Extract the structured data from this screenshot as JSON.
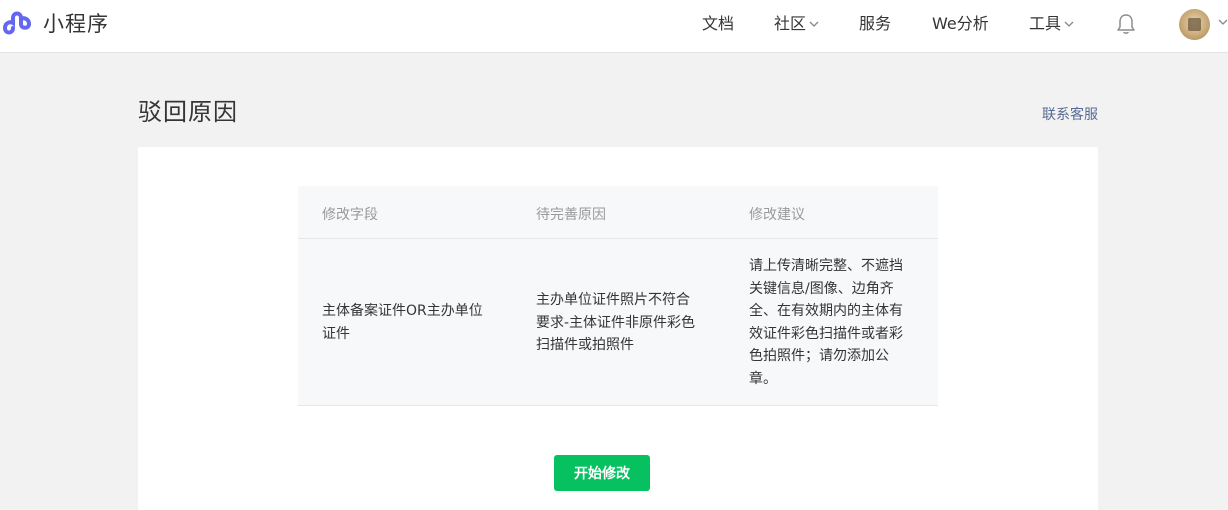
{
  "header": {
    "brand": "小程序",
    "nav": {
      "docs": "文档",
      "community": "社区",
      "services": "服务",
      "we_analytics": "We分析",
      "tools": "工具"
    }
  },
  "page": {
    "title": "驳回原因",
    "contact_label": "联系客服"
  },
  "table": {
    "headers": [
      "修改字段",
      "待完善原因",
      "修改建议"
    ],
    "rows": [
      {
        "field": [
          "主体备案证件OR主办单位",
          "证件"
        ],
        "reason": [
          "主办单位证件照片不符合",
          "要求-主体证件非原件彩色",
          "扫描件或拍照件"
        ],
        "suggestion": [
          "请上传清晰完整、不遮挡",
          "关键信息/图像、边角齐",
          "全、在有效期内的主体有",
          "效证件彩色扫描件或者彩",
          "色拍照件；请勿添加公",
          "章。"
        ]
      }
    ]
  },
  "actions": {
    "start_edit_label": "开始修改"
  },
  "colors": {
    "primary_green": "#07c160",
    "link_blue": "#576b95",
    "logo_purple": "#6467f0"
  }
}
